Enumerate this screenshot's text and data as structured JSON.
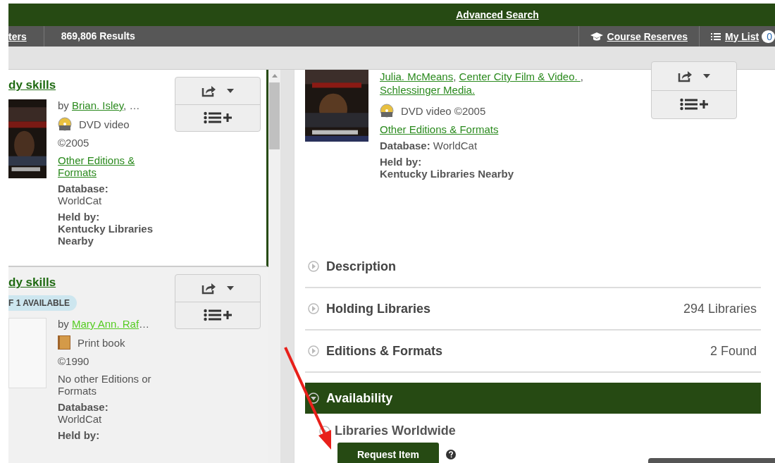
{
  "top_bar": {
    "advanced_search": "Advanced Search"
  },
  "results_bar": {
    "filters_link": "ters",
    "count": "869,806 Results",
    "course_reserves": "Course Reserves",
    "my_list": "My List",
    "my_list_count": "0"
  },
  "results": [
    {
      "title": "dy skills",
      "selected": true,
      "by": "by",
      "author": "Brian. Isley",
      "author_more": ", …",
      "kind": "dvd",
      "format": "DVD video",
      "year": "©2005",
      "editions": "Other Editions & Formats",
      "editions_link": true,
      "database_label": "Database:",
      "database": "WorldCat",
      "held_label": "Held by:",
      "held": "Kentucky Libraries Nearby"
    },
    {
      "title": "dy skills",
      "badge": "F 1 AVAILABLE",
      "selected": false,
      "by": "by",
      "author": "Mary Ann. Raf",
      "author_more": "…",
      "kind": "book",
      "format": "Print book",
      "year": "©1990",
      "editions": "No other Editions or Formats",
      "editions_link": false,
      "database_label": "Database:",
      "database": "WorldCat",
      "held_label": "Held by:"
    }
  ],
  "detail": {
    "authors": [
      {
        "name": "Julia. McMeans",
        "separator": ","
      },
      {
        "name": "Center City Film & Video. ",
        "separator": ","
      },
      {
        "name": "Schlessinger Media."
      }
    ],
    "format": "DVD video ©2005",
    "editions": "Other Editions & Formats",
    "database_label": "Database:",
    "database": "WorldCat",
    "held_label": "Held by:",
    "held": "Kentucky Libraries Nearby",
    "sections": [
      {
        "title": "Description",
        "expanded": false
      },
      {
        "title": "Holding Libraries",
        "count": "294 Libraries",
        "expanded": false
      },
      {
        "title": "Editions & Formats",
        "count": "2 Found",
        "expanded": false
      },
      {
        "title": "Availability",
        "expanded": true
      }
    ],
    "subsection": {
      "title": "Libraries Worldwide",
      "button": "Request Item"
    }
  }
}
